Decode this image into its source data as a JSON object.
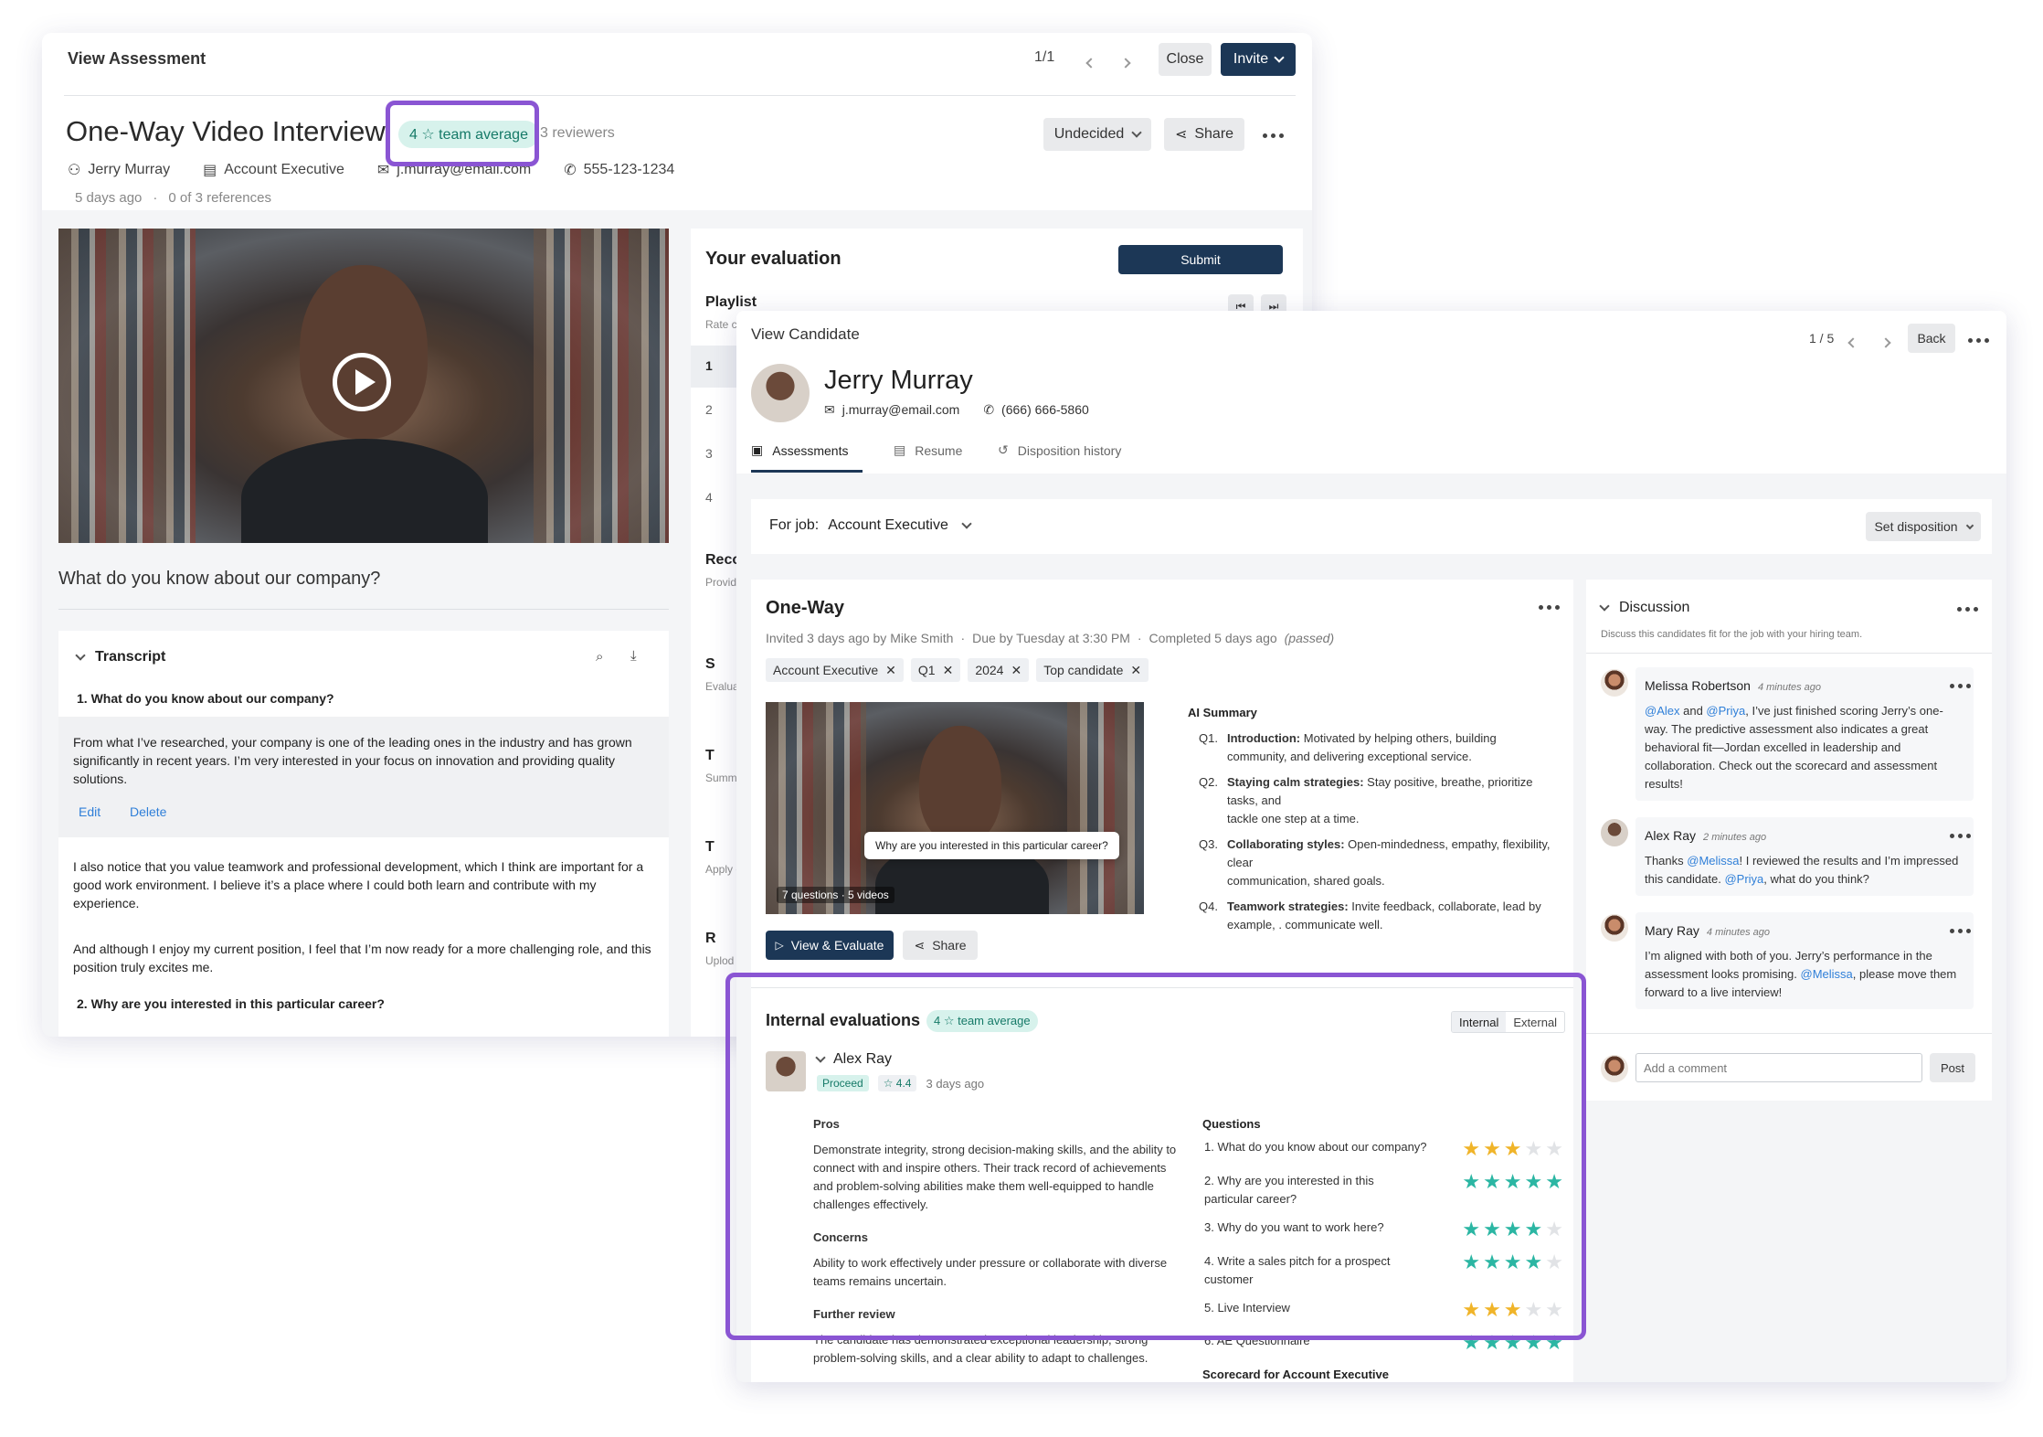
{
  "assessment": {
    "window_title": "View Assessment",
    "pager": "1/1",
    "close_label": "Close",
    "invite_label": "Invite",
    "title": "One-Way Video Interview",
    "team_average": "4 ☆ team average",
    "reviewers": "3 reviewers",
    "status_label": "Undecided",
    "share_label": "Share",
    "candidate_name": "Jerry Murray",
    "job": "Account Executive",
    "email": "j.murray@email.com",
    "phone": "555-123-1234",
    "posted": "5 days ago",
    "references": "0 of 3 references",
    "question_heading": "What do you know about our company?",
    "transcript": {
      "label": "Transcript",
      "q1": "1. What do you know about our company?",
      "answer1": "From what I’ve researched, your company is one of the leading ones in the industry and has grown significantly in recent years. I’m very interested in your focus on innovation and providing quality solutions.",
      "edit_label": "Edit",
      "delete_label": "Delete",
      "answer2": "I also notice that you value teamwork and professional development, which I think are important for a good work environment. I believe it’s a place where I could both learn and contribute with my experience.",
      "answer3": "And although I enjoy my current position, I feel that I’m now ready for a more challenging role, and this position truly excites me.",
      "q2": "2. Why are you interested in this particular career?"
    },
    "evaluation": {
      "title": "Your evaluation",
      "submit_label": "Submit",
      "playlist_label": "Playlist",
      "rate_hint": "Rate ca",
      "items": [
        "1",
        "2",
        "3",
        "4"
      ],
      "reco_label": "Reco",
      "reco_hint": "Provide",
      "sections": [
        {
          "label": "S",
          "hint": "Evaluat"
        },
        {
          "label": "T",
          "hint": "Summa"
        },
        {
          "label": "T",
          "hint": "Apply c"
        },
        {
          "label": "R",
          "hint": "Uplod"
        }
      ]
    }
  },
  "candidate": {
    "window_title": "View Candidate",
    "pager": "1 / 5",
    "back_label": "Back",
    "name": "Jerry Murray",
    "email": "j.murray@email.com",
    "phone": "(666) 666-5860",
    "tabs": [
      "Assessments",
      "Resume",
      "Disposition history"
    ],
    "for_job_label": "For job:",
    "for_job_value": "Account Executive",
    "set_disposition_label": "Set disposition",
    "oneway": {
      "title": "One-Way",
      "invited": "Invited 3 days ago by Mike Smith",
      "due": "Due by Tuesday at 3:30 PM",
      "completed": "Completed 5 days ago",
      "passed": "(passed)",
      "tags": [
        "Account Executive",
        "Q1",
        "2024",
        "Top candidate"
      ],
      "video_caption": "Why are you interested in this particular career?",
      "video_meta": "7 questions · 5 videos",
      "view_label": "View & Evaluate",
      "share_label": "Share",
      "ai_summary_label": "AI Summary",
      "summary": [
        {
          "q": "Q1.",
          "title": "Introduction:",
          "line1": "Motivated by helping others, building",
          "line2": "community, and delivering  exceptional service.",
          "line3": ""
        },
        {
          "q": "Q2.",
          "title": "Staying calm strategies:",
          "line1": "Stay positive, breathe, prioritize",
          "line2": "tasks, and",
          "line3": "tackle one step at a time."
        },
        {
          "q": "Q3.",
          "title": "Collaborating styles:",
          "line1": "Open-mindedness, empathy, flexibility,",
          "line2": "clear",
          "line3": "communication, shared goals."
        },
        {
          "q": "Q4.",
          "title": "Teamwork strategies:",
          "line1": "Invite feedback, collaborate, lead by",
          "line2": "example,  .                      communicate well.",
          "line3": ""
        }
      ]
    },
    "internal": {
      "title": "Internal evaluations",
      "team_average": "4 ☆ team average",
      "toggle_internal": "Internal",
      "toggle_external": "External",
      "reviewer_name": "Alex Ray",
      "decision": "Proceed",
      "score": "☆ 4.4",
      "when": "3 days ago",
      "pros_label": "Pros",
      "pros_text": "Demonstrate integrity, strong decision-making skills, and the ability to connect with and inspire others. Their track record of achievements and problem-solving abilities make them well-equipped to handle challenges effectively.",
      "concerns_label": "Concerns",
      "concerns_text": "Ability to work effectively under pressure or collaborate with diverse teams remains uncertain.",
      "further_label": "Further review",
      "further_text": "The candidate has demonstrated exceptional leadership, strong problem-solving skills, and a clear ability to adapt to challenges.",
      "questions_label": "Questions",
      "questions": [
        {
          "label": "1. What do you know about our company?",
          "label2": "",
          "rating": 3,
          "color": "#f0b429"
        },
        {
          "label": "2. Why are you interested in this",
          "label2": "particular career?",
          "rating": 5,
          "color": "#2bb6a3"
        },
        {
          "label": "3. Why do you want to work here?",
          "label2": "",
          "rating": 4,
          "color": "#2bb6a3"
        },
        {
          "label": "4. Write a sales pitch for a prospect",
          "label2": "customer",
          "rating": 4,
          "color": "#2bb6a3"
        },
        {
          "label": "5. Live Interview",
          "label2": "",
          "rating": 3,
          "color": "#f0b429"
        },
        {
          "label": "6. AE Questionnaire",
          "label2": "",
          "rating": 5,
          "color": "#2bb6a3"
        }
      ],
      "scorecard_label": "Scorecard for Account Executive"
    },
    "discussion": {
      "title": "Discussion",
      "hint": "Discuss this candidates fit for the job with your hiring team.",
      "comments": [
        {
          "author": "Melissa Robertson",
          "time": "4 minutes ago",
          "m1": "@Alex",
          "t1": " and ",
          "m2": "@Priya",
          "t2": ", I’ve just finished scoring Jerry’s one-way. The predictive assessment also indicates a great behavioral fit—Jordan excelled in leadership and collaboration. Check out the scorecard and assessment results!",
          "m3": "",
          "t3": ""
        },
        {
          "author": "Alex Ray",
          "time": "2 minutes ago",
          "m1": "",
          "t1": "Thanks ",
          "m2": "@Melissa",
          "t2": "! I reviewed the results and I’m impressed this candidate. ",
          "m3": "@Priya",
          "t3": ", what do you think?"
        },
        {
          "author": "Mary Ray",
          "time": "4 minutes ago",
          "m1": "",
          "t1": "I’m aligned with both of you. Jerry’s performance in the assessment looks promising. ",
          "m2": "@Melissa",
          "t2": ", please move them forward to a live interview!",
          "m3": "",
          "t3": ""
        }
      ],
      "comment_placeholder": "Add a comment",
      "post_label": "Post"
    }
  },
  "colors": {
    "accent": "#8a55d3",
    "dark_button": "#1c3756",
    "teal": "#2bb6a3",
    "gold": "#f0b429",
    "mention": "#2f7fd8"
  }
}
